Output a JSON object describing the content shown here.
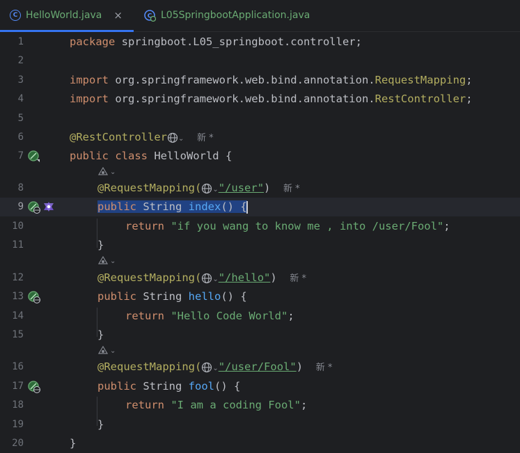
{
  "tabs": [
    {
      "label": "HelloWorld.java",
      "icon": "class-c-icon",
      "active": true,
      "close": "×"
    },
    {
      "label": "L05SpringbootApplication.java",
      "icon": "spring-boot-app-icon",
      "active": false
    }
  ],
  "code": {
    "line1": {
      "num": "1",
      "kw": "package",
      "rest": " springboot.L05_springboot.controller;"
    },
    "line2": {
      "num": "2"
    },
    "line3": {
      "num": "3",
      "kw": "import",
      "rest": " org.springframework.web.bind.annotation.",
      "cls": "RequestMapping",
      "end": ";"
    },
    "line4": {
      "num": "4",
      "kw": "import",
      "rest": " org.springframework.web.bind.annotation.",
      "cls": "RestController",
      "end": ";"
    },
    "line5": {
      "num": "5"
    },
    "line6": {
      "num": "6",
      "ann": "@RestController",
      "hint": "新 *"
    },
    "line7": {
      "num": "7",
      "kw": "public class",
      "rest": " HelloWorld {"
    },
    "line8": {
      "num": "8",
      "ann": "@RequestMapping(",
      "path": "\"/user\"",
      "end": ")",
      "hint": "新 *"
    },
    "line9": {
      "num": "9",
      "kw": "public",
      "type": " String ",
      "fn": "index",
      "end": "() ",
      "brace": "{"
    },
    "line10": {
      "num": "10",
      "kw": "return",
      "str": " \"if you wang to know me , into /user/Fool\"",
      "end": ";"
    },
    "line11": {
      "num": "11",
      "text": "}"
    },
    "line12": {
      "num": "12",
      "ann": "@RequestMapping(",
      "path": "\"/hello\"",
      "end": ")",
      "hint": "新 *"
    },
    "line13": {
      "num": "13",
      "kw": "public",
      "type": " String ",
      "fn": "hello",
      "end": "() {"
    },
    "line14": {
      "num": "14",
      "kw": "return",
      "str": " \"Hello Code World\"",
      "end": ";"
    },
    "line15": {
      "num": "15",
      "text": "}"
    },
    "line16": {
      "num": "16",
      "ann": "@RequestMapping(",
      "path": "\"/user/Fool\"",
      "end": ")",
      "hint": "新 *"
    },
    "line17": {
      "num": "17",
      "kw": "public",
      "type": " String ",
      "fn": "fool",
      "end": "() {"
    },
    "line18": {
      "num": "18",
      "kw": "return",
      "str": " \"I am a coding Fool\"",
      "end": ";"
    },
    "line19": {
      "num": "19",
      "text": "}"
    },
    "line20": {
      "num": "20",
      "text": "}"
    }
  },
  "colors": {
    "background": "#1e1f22",
    "keyword": "#cf8e6d",
    "annotation": "#b3ae60",
    "string": "#6aab73",
    "function": "#56a8f5",
    "selection": "#214283",
    "tab_underline": "#3574f0"
  }
}
